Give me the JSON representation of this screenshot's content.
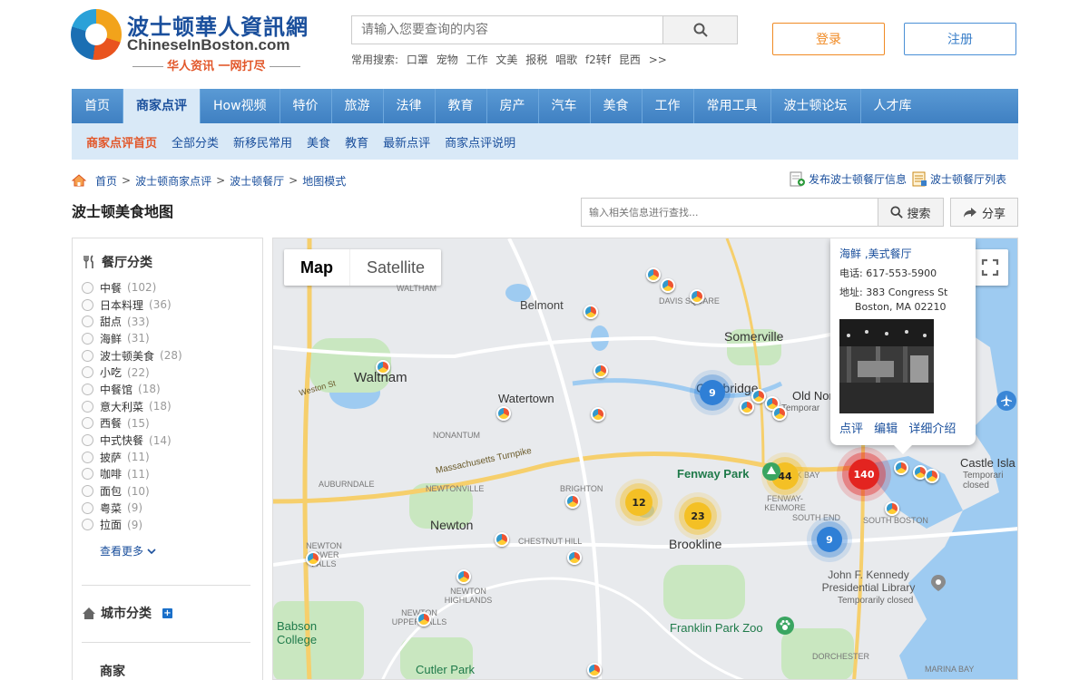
{
  "header": {
    "logo_cn": "波士顿華人資訊網",
    "logo_en": "ChineseInBoston.com",
    "slogan": "华人资讯 一网打尽",
    "search_placeholder": "请输入您要查询的内容",
    "hot_label": "常用搜索:",
    "hot_terms": [
      "口罩",
      "宠物",
      "工作",
      "文美",
      "报税",
      "唱歌",
      "f2转f",
      "昆西",
      ">>"
    ],
    "login": "登录",
    "register": "注册"
  },
  "nav": [
    "首页",
    "商家点评",
    "How视频",
    "特价",
    "旅游",
    "法律",
    "教育",
    "房产",
    "汽车",
    "美食",
    "工作",
    "常用工具",
    "波士顿论坛",
    "人才库"
  ],
  "subnav": [
    "商家点评首页",
    "全部分类",
    "新移民常用",
    "美食",
    "教育",
    "最新点评",
    "商家点评说明"
  ],
  "breadcrumb": [
    "首页",
    "波士顿商家点评",
    "波士顿餐厅",
    "地图模式"
  ],
  "breadcrumb_sep": ">",
  "toplinks": [
    "发布波士顿餐厅信息",
    "波士顿餐厅列表"
  ],
  "page_title": "波士顿美食地图",
  "map_search": {
    "placeholder": "输入相关信息进行查找...",
    "button": "搜索"
  },
  "share": "分享",
  "sidebar": {
    "cat_title": "餐厅分类",
    "categories": [
      {
        "name": "中餐",
        "count": "(102)"
      },
      {
        "name": "日本料理",
        "count": "(36)"
      },
      {
        "name": "甜点",
        "count": "(33)"
      },
      {
        "name": "海鲜",
        "count": "(31)"
      },
      {
        "name": "波士顿美食",
        "count": "(28)"
      },
      {
        "name": "小吃",
        "count": "(22)"
      },
      {
        "name": "中餐馆",
        "count": "(18)"
      },
      {
        "name": "意大利菜",
        "count": "(18)"
      },
      {
        "name": "西餐",
        "count": "(15)"
      },
      {
        "name": "中式快餐",
        "count": "(14)"
      },
      {
        "name": "披萨",
        "count": "(11)"
      },
      {
        "name": "咖啡",
        "count": "(11)"
      },
      {
        "name": "面包",
        "count": "(10)"
      },
      {
        "name": "粤菜",
        "count": "(9)"
      },
      {
        "name": "拉面",
        "count": "(9)"
      }
    ],
    "more": "查看更多",
    "city_title": "城市分类",
    "shop_title": "商家"
  },
  "map": {
    "type_map": "Map",
    "type_satellite": "Satellite",
    "labels": [
      "Belmont",
      "Somerville",
      "Waltham",
      "Watertown",
      "Cambridge",
      "Old North",
      "Newton",
      "Brookline",
      "Fenway Park",
      "Castle Isla",
      "Babson College",
      "Franklin Park Zoo",
      "Cutler Park",
      "John F. Kennedy Presidential Library",
      "Temporarily closed",
      "WALTHAM",
      "DAVIS SQUARE",
      "NONANTUM",
      "NEWTONVILLE",
      "AUBURNDALE",
      "BRIGHTON",
      "CHESTNUT HILL",
      "NEWTON LOWER FALLS",
      "NEWTON HIGHLANDS",
      "NEWTON UPPER FALLS",
      "FENWAY-KENMORE",
      "SOUTH END",
      "SOUTH BOSTON",
      "DORCHESTER",
      "MARINA BAY",
      "Massachusetts Turnpike",
      "Weston St",
      "CK BAY",
      "Temporar",
      "Temporari closed"
    ],
    "clusters": [
      {
        "label": "9",
        "kind": "blue"
      },
      {
        "label": "44",
        "kind": "yellow"
      },
      {
        "label": "140",
        "kind": "red"
      },
      {
        "label": "12",
        "kind": "yellow"
      },
      {
        "label": "23",
        "kind": "yellow"
      },
      {
        "label": "9",
        "kind": "blue"
      }
    ],
    "popup": {
      "name": "海鲜 ,美式餐厅",
      "phone": "电话: 617-553-5900",
      "address1": "地址: 383 Congress St",
      "address2": "Boston, MA 02210",
      "links": [
        "点评",
        "编辑",
        "详细介绍"
      ]
    }
  }
}
